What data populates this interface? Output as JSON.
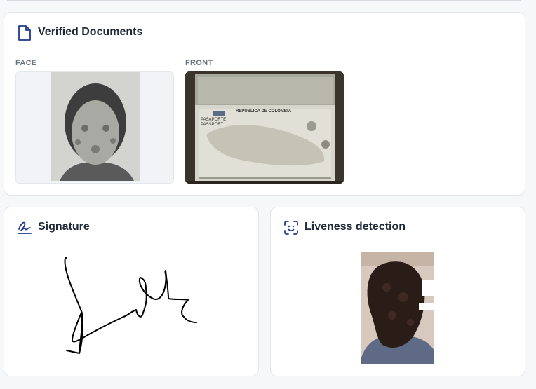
{
  "verified_documents": {
    "title": "Verified Documents",
    "icon": "document-icon",
    "documents": [
      {
        "label": "FACE"
      },
      {
        "label": "FRONT",
        "passport_header": "REPUBLICA DE COLOMBIA",
        "passport_sub": "PASAPORTE",
        "passport_sub2": "PASSPORT"
      }
    ]
  },
  "signature": {
    "title": "Signature",
    "icon": "signature-icon"
  },
  "liveness": {
    "title": "Liveness detection",
    "icon": "face-scan-icon"
  },
  "colors": {
    "accent": "#1e3a8a",
    "card_border": "#e3e6eb",
    "background": "#f6f7f9",
    "label_gray": "#6b7280"
  }
}
